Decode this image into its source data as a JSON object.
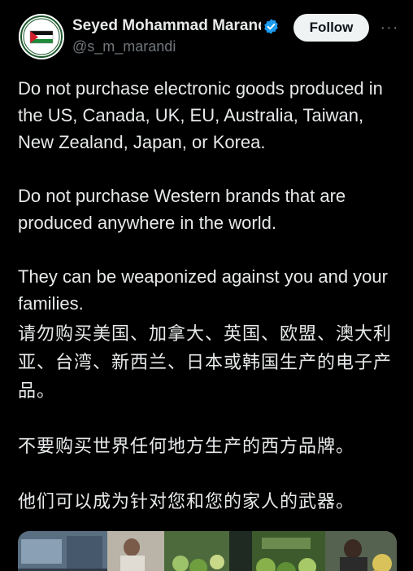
{
  "post": {
    "display_name": "Seyed Mohammad Marandi",
    "handle": "@s_m_marandi",
    "follow_label": "Follow",
    "more_label": "···",
    "paragraphs": [
      "Do not purchase electronic goods produced in the US, Canada, UK, EU, Australia, Taiwan, New Zealand, Japan, or Korea.",
      "Do not purchase Western brands that are produced anywhere in the world.",
      "They can be weaponized against you and your families.",
      "请勿购买美国、加拿大、英国、欧盟、澳大利亚、台湾、新西兰、日本或韩国生产的电子产品。",
      "不要购买世界任何地方生产的西方品牌。",
      "他们可以成为针对您和您的家人的武器。"
    ]
  },
  "icons": {
    "avatar": "palestine-flag-avatar",
    "verified": "verified-badge-icon",
    "more": "more-options-icon"
  },
  "colors": {
    "background": "#000000",
    "text": "#e7e9ea",
    "secondary_text": "#71767b",
    "verified_blue": "#1d9bf0",
    "follow_button_bg": "#eff3f4",
    "follow_button_text": "#0f1419"
  }
}
